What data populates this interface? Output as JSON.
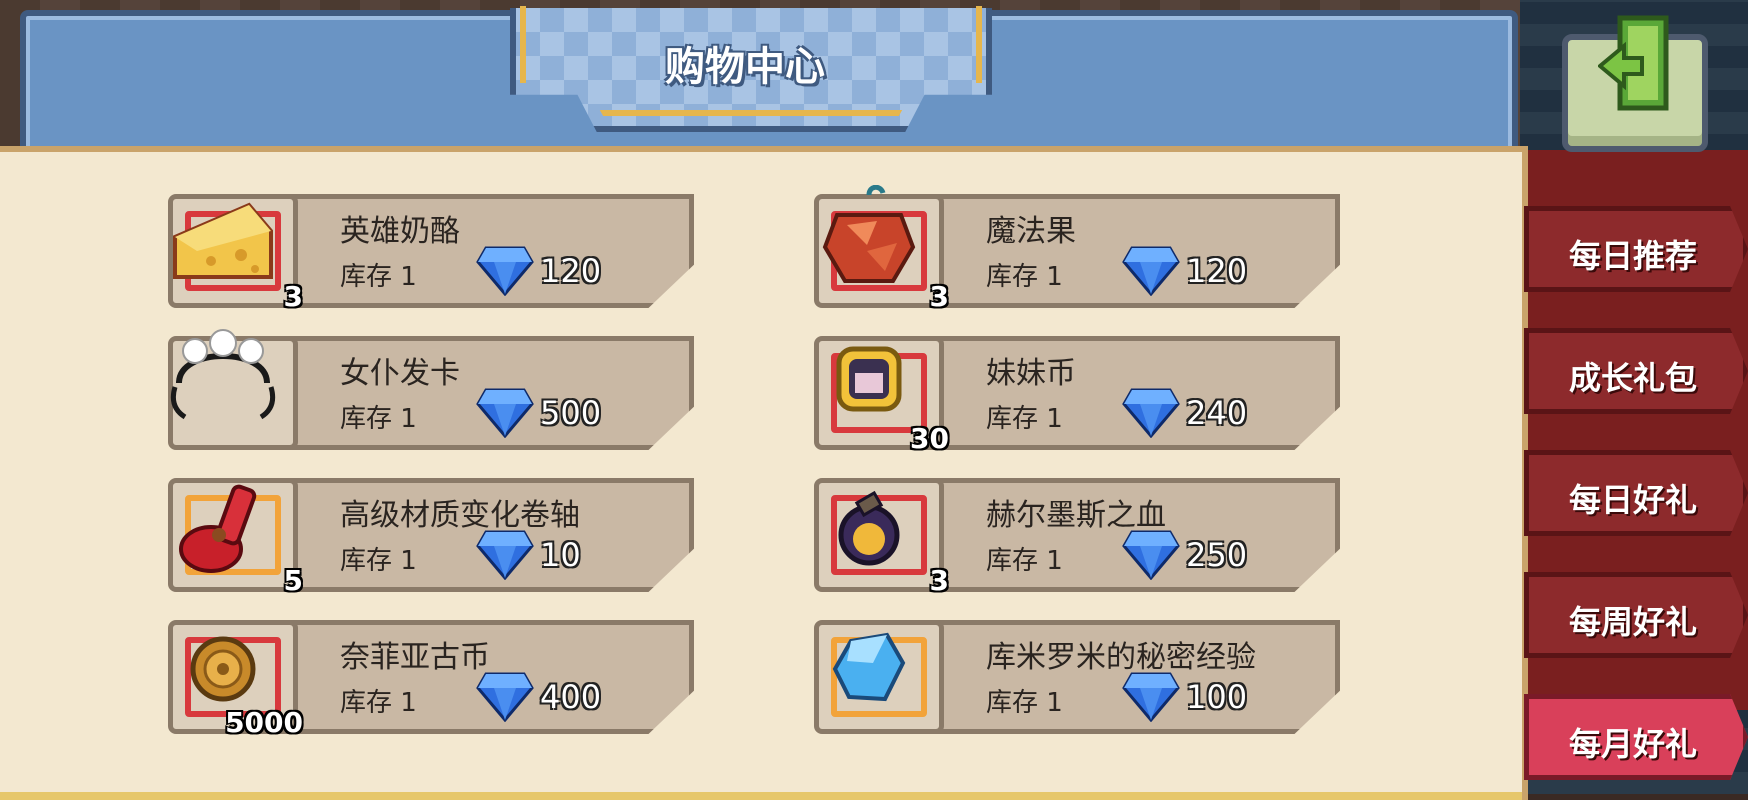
{
  "title": "购物中心",
  "stock_label": "库存 1",
  "colors": {
    "panel_blue": "#6a94c4",
    "content_bg": "#f3e8d0",
    "tab_red": "#8d2a2c",
    "tab_active": "#d9405a",
    "frame_red": "#d8393d",
    "frame_gold": "#f2a33a"
  },
  "items": [
    {
      "name": "英雄奶酪",
      "qty": "3",
      "price": "120",
      "icon": "cheese-icon",
      "frame": "red"
    },
    {
      "name": "魔法果",
      "qty": "3",
      "price": "120",
      "icon": "magic-fruit-icon",
      "frame": "red"
    },
    {
      "name": "女仆发卡",
      "qty": "",
      "price": "500",
      "icon": "maid-headband-icon",
      "frame": "none"
    },
    {
      "name": "妹妹币",
      "qty": "30",
      "price": "240",
      "icon": "sister-coin-icon",
      "frame": "red"
    },
    {
      "name": "高级材质变化卷轴",
      "qty": "5",
      "price": "10",
      "icon": "scroll-icon",
      "frame": "gold"
    },
    {
      "name": "赫尔墨斯之血",
      "qty": "3",
      "price": "250",
      "icon": "potion-icon",
      "frame": "red"
    },
    {
      "name": "奈菲亚古币",
      "qty": "5000",
      "price": "400",
      "icon": "ancient-coin-icon",
      "frame": "red"
    },
    {
      "name": "库米罗米的秘密经验",
      "qty": "",
      "price": "100",
      "icon": "crystal-icon",
      "frame": "gold"
    }
  ],
  "tabs": [
    {
      "label": "每日推荐"
    },
    {
      "label": "成长礼包"
    },
    {
      "label": "每日好礼"
    },
    {
      "label": "每周好礼"
    },
    {
      "label": "每月好礼"
    }
  ],
  "currency_icon": "diamond-icon",
  "exit_icon": "exit-door-icon"
}
